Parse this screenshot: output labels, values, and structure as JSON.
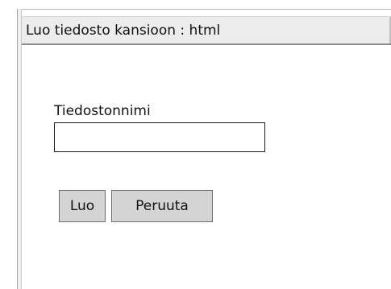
{
  "dialog": {
    "title": "Luo tiedosto kansioon : html"
  },
  "form": {
    "filename_label": "Tiedostonnimi",
    "filename_value": "",
    "filename_placeholder": ""
  },
  "buttons": {
    "create_label": "Luo",
    "cancel_label": "Peruuta"
  },
  "colors": {
    "title_bar_bg": "#ececec",
    "button_bg": "#d4d4d4",
    "text": "#111111"
  }
}
